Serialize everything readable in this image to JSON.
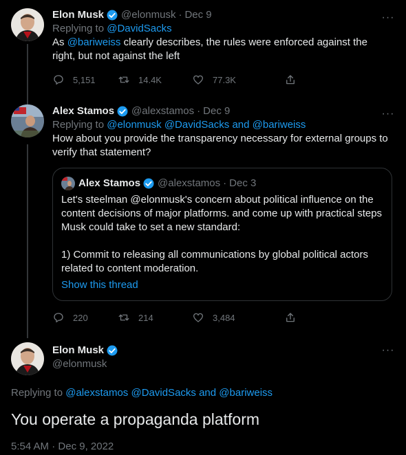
{
  "tweet1": {
    "name": "Elon Musk",
    "handle": "@elonmusk",
    "sep": "·",
    "date": "Dec 9",
    "replying_prefix": "Replying to",
    "replying_to": "@DavidSacks",
    "text_mention": "@bariweiss",
    "text_pre": "As",
    "text_post": " clearly describes, the rules were enforced against the right, but not against the left",
    "replies": "5,151",
    "retweets": "14.4K",
    "likes": "77.3K"
  },
  "tweet2": {
    "name": "Alex Stamos",
    "handle": "@alexstamos",
    "sep": "·",
    "date": "Dec 9",
    "replying_prefix": "Replying to",
    "replying_to_1": "@elonmusk",
    "replying_to_2": "@DavidSacks",
    "and": "and",
    "replying_to_3": "@bariweiss",
    "text": "How about you provide the transparency necessary for external groups to verify that statement?",
    "replies": "220",
    "retweets": "214",
    "likes": "3,484",
    "quote": {
      "name": "Alex Stamos",
      "handle": "@alexstamos",
      "sep": "·",
      "date": "Dec 3",
      "para1": "Let's steelman @elonmusk's concern about political influence on the content decisions of major platforms. and come up with practical steps Musk could take to set a new standard:",
      "para2": "1) Commit to releasing all communications by global political actors related to content moderation.",
      "show_thread": "Show this thread"
    }
  },
  "main": {
    "name": "Elon Musk",
    "handle": "@elonmusk",
    "replying_prefix": "Replying to",
    "replying_to_1": "@alexstamos",
    "replying_to_2": "@DavidSacks",
    "and": "and",
    "replying_to_3": "@bariweiss",
    "text": "You operate a propaganda platform",
    "time": "5:54 AM",
    "sep": "·",
    "date": "Dec 9, 2022"
  },
  "more_glyph": "···"
}
